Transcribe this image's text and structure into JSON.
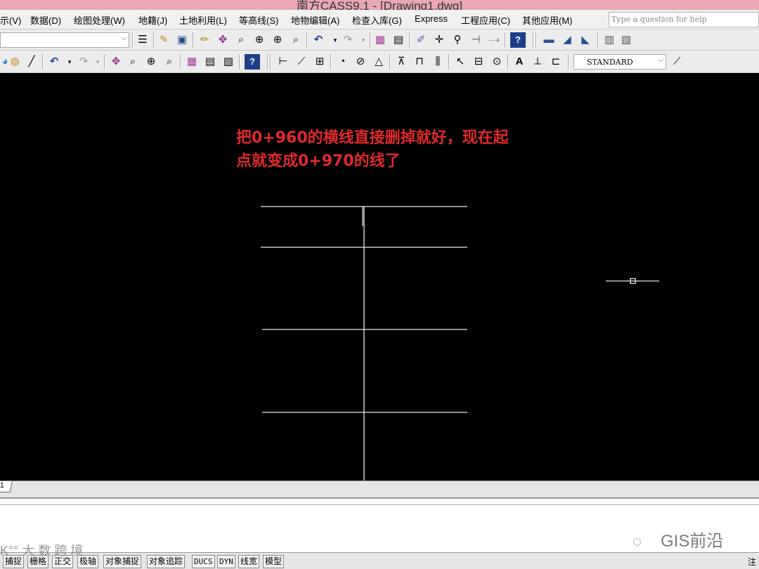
{
  "window": {
    "title": "南方CASS9.1 - [Drawing1.dwg]"
  },
  "menu": {
    "items": [
      "示(V)",
      "数据(D)",
      "绘图处理(W)",
      "地籍(J)",
      "土地利用(L)",
      "等高线(S)",
      "地物编辑(A)",
      "检查入库(G)",
      "Express",
      "工程应用(C)",
      "其他应用(M)"
    ],
    "help_placeholder": "Type a question for help"
  },
  "toolbar2": {
    "text_style": "STANDARD"
  },
  "canvas": {
    "annotation_line1": "把0+960的横线直接删掉就好，现在起",
    "annotation_line2": "点就变成0+970的线了",
    "annotation_color": "#e02a2a",
    "line_color": "#e8e8e8"
  },
  "layout_tab": {
    "label": "1"
  },
  "watermark": {
    "brand": "GIS前沿",
    "overlay": "K°° 大 数 跨 境"
  },
  "status": {
    "toggles": [
      "捕捉",
      "栅格",
      "正交",
      "极轴",
      "对象捕捉",
      "对象追踪",
      "DUCS",
      "DYN",
      "线宽",
      "模型"
    ],
    "right_label": "注"
  }
}
